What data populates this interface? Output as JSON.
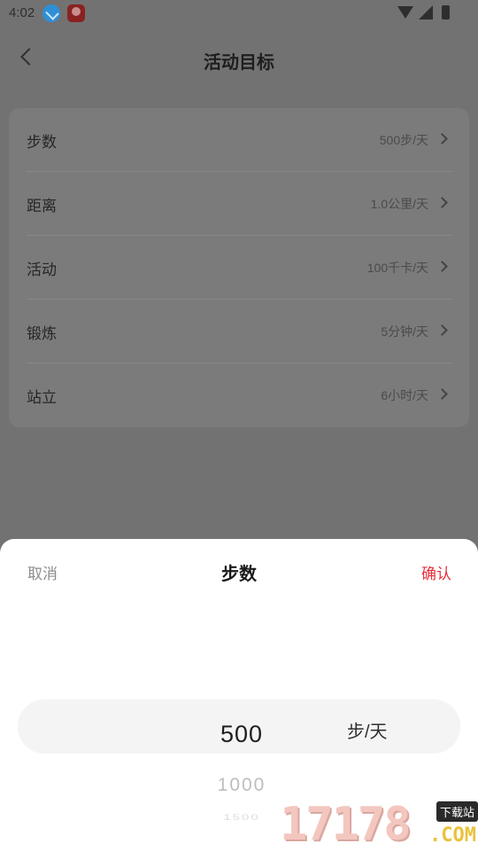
{
  "status_bar": {
    "time": "4:02",
    "icons": [
      "download-icon",
      "news-app-icon",
      "wifi-icon",
      "signal-icon",
      "battery-icon"
    ]
  },
  "nav": {
    "title": "活动目标",
    "back_icon": "chevron-left-icon"
  },
  "goals": [
    {
      "label": "步数",
      "value": "500步/天"
    },
    {
      "label": "距离",
      "value": "1.0公里/天"
    },
    {
      "label": "活动",
      "value": "100千卡/天"
    },
    {
      "label": "锻炼",
      "value": "5分钟/天"
    },
    {
      "label": "站立",
      "value": "6小时/天"
    }
  ],
  "sheet": {
    "cancel_label": "取消",
    "title": "步数",
    "confirm_label": "确认",
    "confirm_color": "#e8303a",
    "picker": {
      "selected": "500",
      "unit": "步/天",
      "next": "1000",
      "next2": "1500"
    }
  },
  "watermark": {
    "digits": "17178",
    "badge": "下载站",
    "suffix": ".COM"
  }
}
